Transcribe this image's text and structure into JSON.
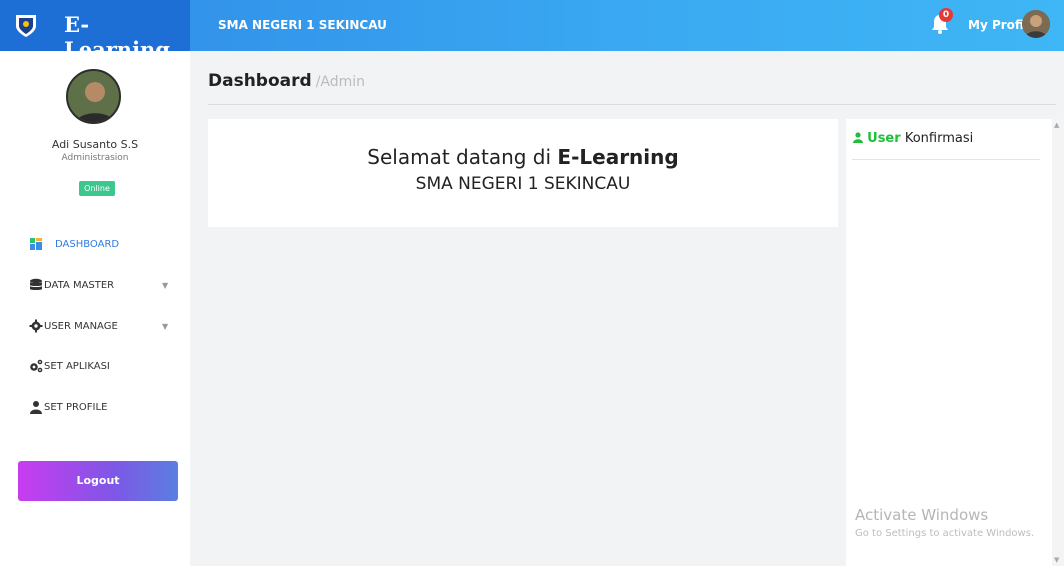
{
  "header": {
    "brand": "E-Learning",
    "school_name": "SMA NEGERI 1 SEKINCAU",
    "notification_count": "0",
    "profile_label": "My Profile"
  },
  "sidebar": {
    "user_name": "Adi Susanto S.S",
    "user_role": "Administrasion",
    "status": "Online",
    "items": [
      {
        "label": "DASHBOARD",
        "icon": "dashboard-icon",
        "active": true
      },
      {
        "label": "DATA MASTER",
        "icon": "database-icon",
        "has_submenu": true
      },
      {
        "label": "USER MANAGE",
        "icon": "cog-icon",
        "has_submenu": true
      },
      {
        "label": "SET APLIKASI",
        "icon": "cogs-icon"
      },
      {
        "label": "SET PROFILE",
        "icon": "user-icon"
      }
    ],
    "logout_label": "Logout"
  },
  "main": {
    "title": "Dashboard",
    "subtitle": "/Admin",
    "welcome_prefix": "Selamat datang di",
    "welcome_brand": "E-Learning",
    "welcome_school": "SMA NEGERI 1 SEKINCAU"
  },
  "right_panel": {
    "title_highlight": "User",
    "title_rest": "Konfirmasi"
  },
  "watermark": {
    "title": "Activate Windows",
    "subtitle": "Go to Settings to activate Windows."
  },
  "colors": {
    "topbar": "#3aa9f2",
    "brand_bg": "#1d6fd6",
    "active_menu": "#2f7be0",
    "online_badge": "#3cc78f",
    "user_green": "#1fbf3a"
  }
}
